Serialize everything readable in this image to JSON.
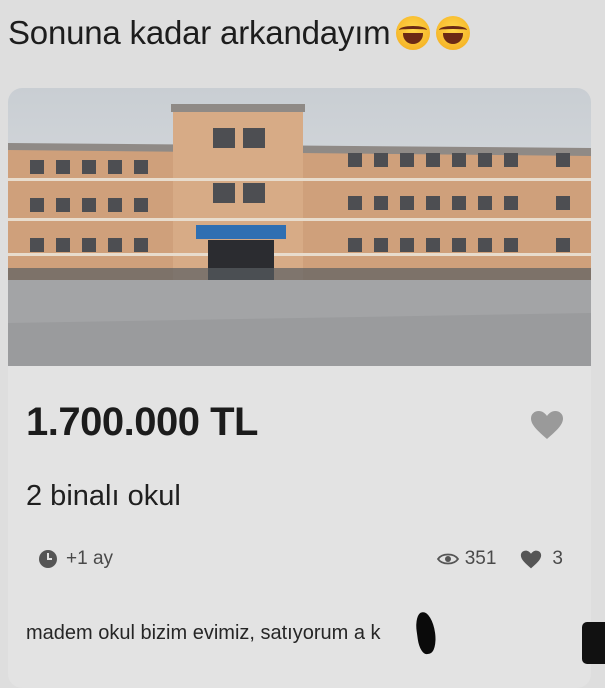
{
  "post": {
    "caption": "Sonuna kadar arkandayım",
    "caption_emojis": [
      "face-with-tears-of-joy",
      "face-with-tears-of-joy"
    ]
  },
  "listing": {
    "price": "1.700.000 TL",
    "title": "2 binalı okul",
    "posted_age": "+1 ay",
    "views": "351",
    "likes": "3",
    "description": "madem okul bizim evimiz, satıyorum a     k"
  },
  "colors": {
    "background": "#dedede",
    "card": "#e3e3e3",
    "building": "#d9a57a",
    "icon": "#888888"
  }
}
